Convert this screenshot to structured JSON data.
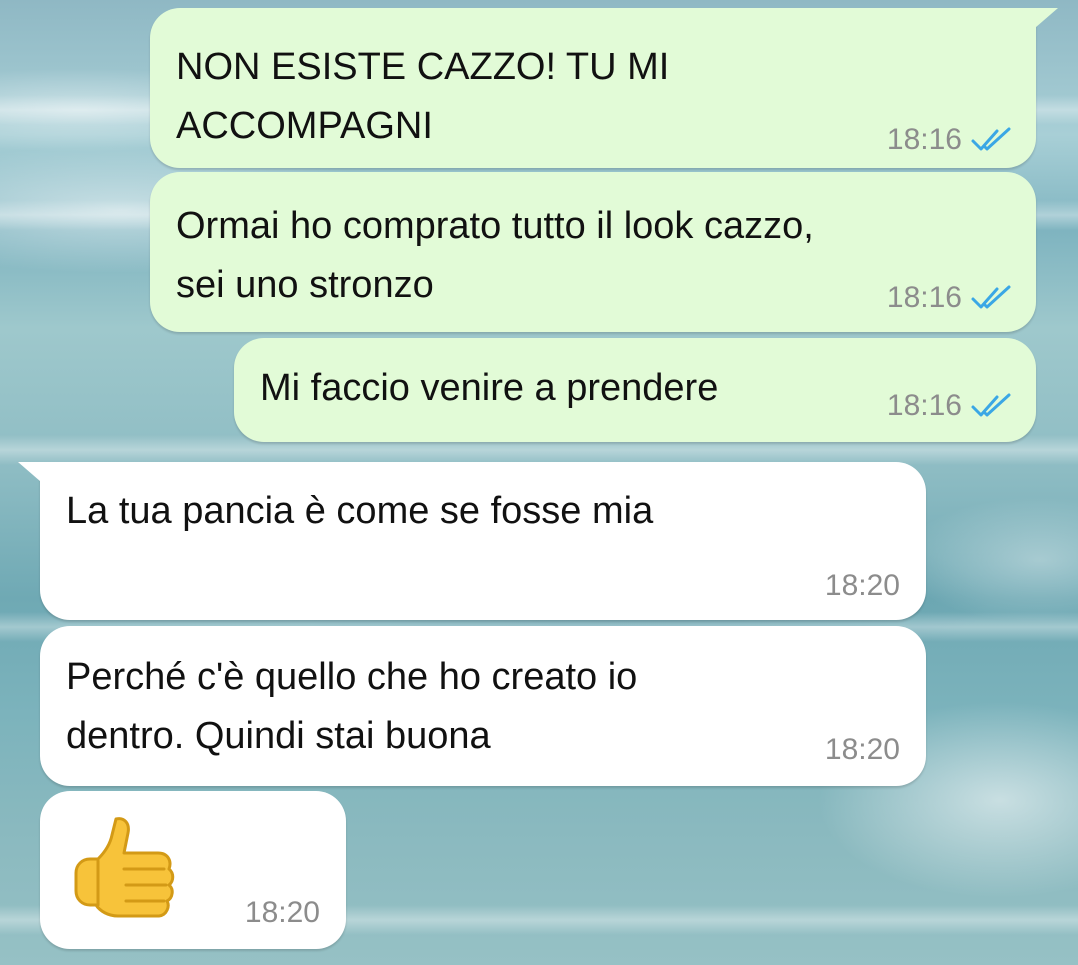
{
  "chat": {
    "messages": [
      {
        "direction": "outgoing",
        "text": "NON ESISTE CAZZO! TU MI\nACCOMPAGNI",
        "time": "18:16",
        "status_icon": "double-check-read-icon"
      },
      {
        "direction": "outgoing",
        "text": "Ormai ho comprato tutto il look cazzo,\nsei uno stronzo",
        "time": "18:16",
        "status_icon": "double-check-read-icon"
      },
      {
        "direction": "outgoing",
        "text": "Mi faccio venire a prendere",
        "time": "18:16",
        "status_icon": "double-check-read-icon"
      },
      {
        "direction": "incoming",
        "text": "La tua pancia è come se fosse mia",
        "time": "18:20"
      },
      {
        "direction": "incoming",
        "text": "Perché c'è quello che ho creato io\ndentro. Quindi stai buona",
        "time": "18:20"
      },
      {
        "direction": "incoming",
        "emoji": "thumbs-up-icon",
        "time": "18:20"
      }
    ]
  },
  "colors": {
    "outgoing_bubble": "#e2fbd7",
    "incoming_bubble": "#ffffff",
    "read_ticks": "#3ba7e5",
    "timestamp": "#8c8c8c"
  }
}
